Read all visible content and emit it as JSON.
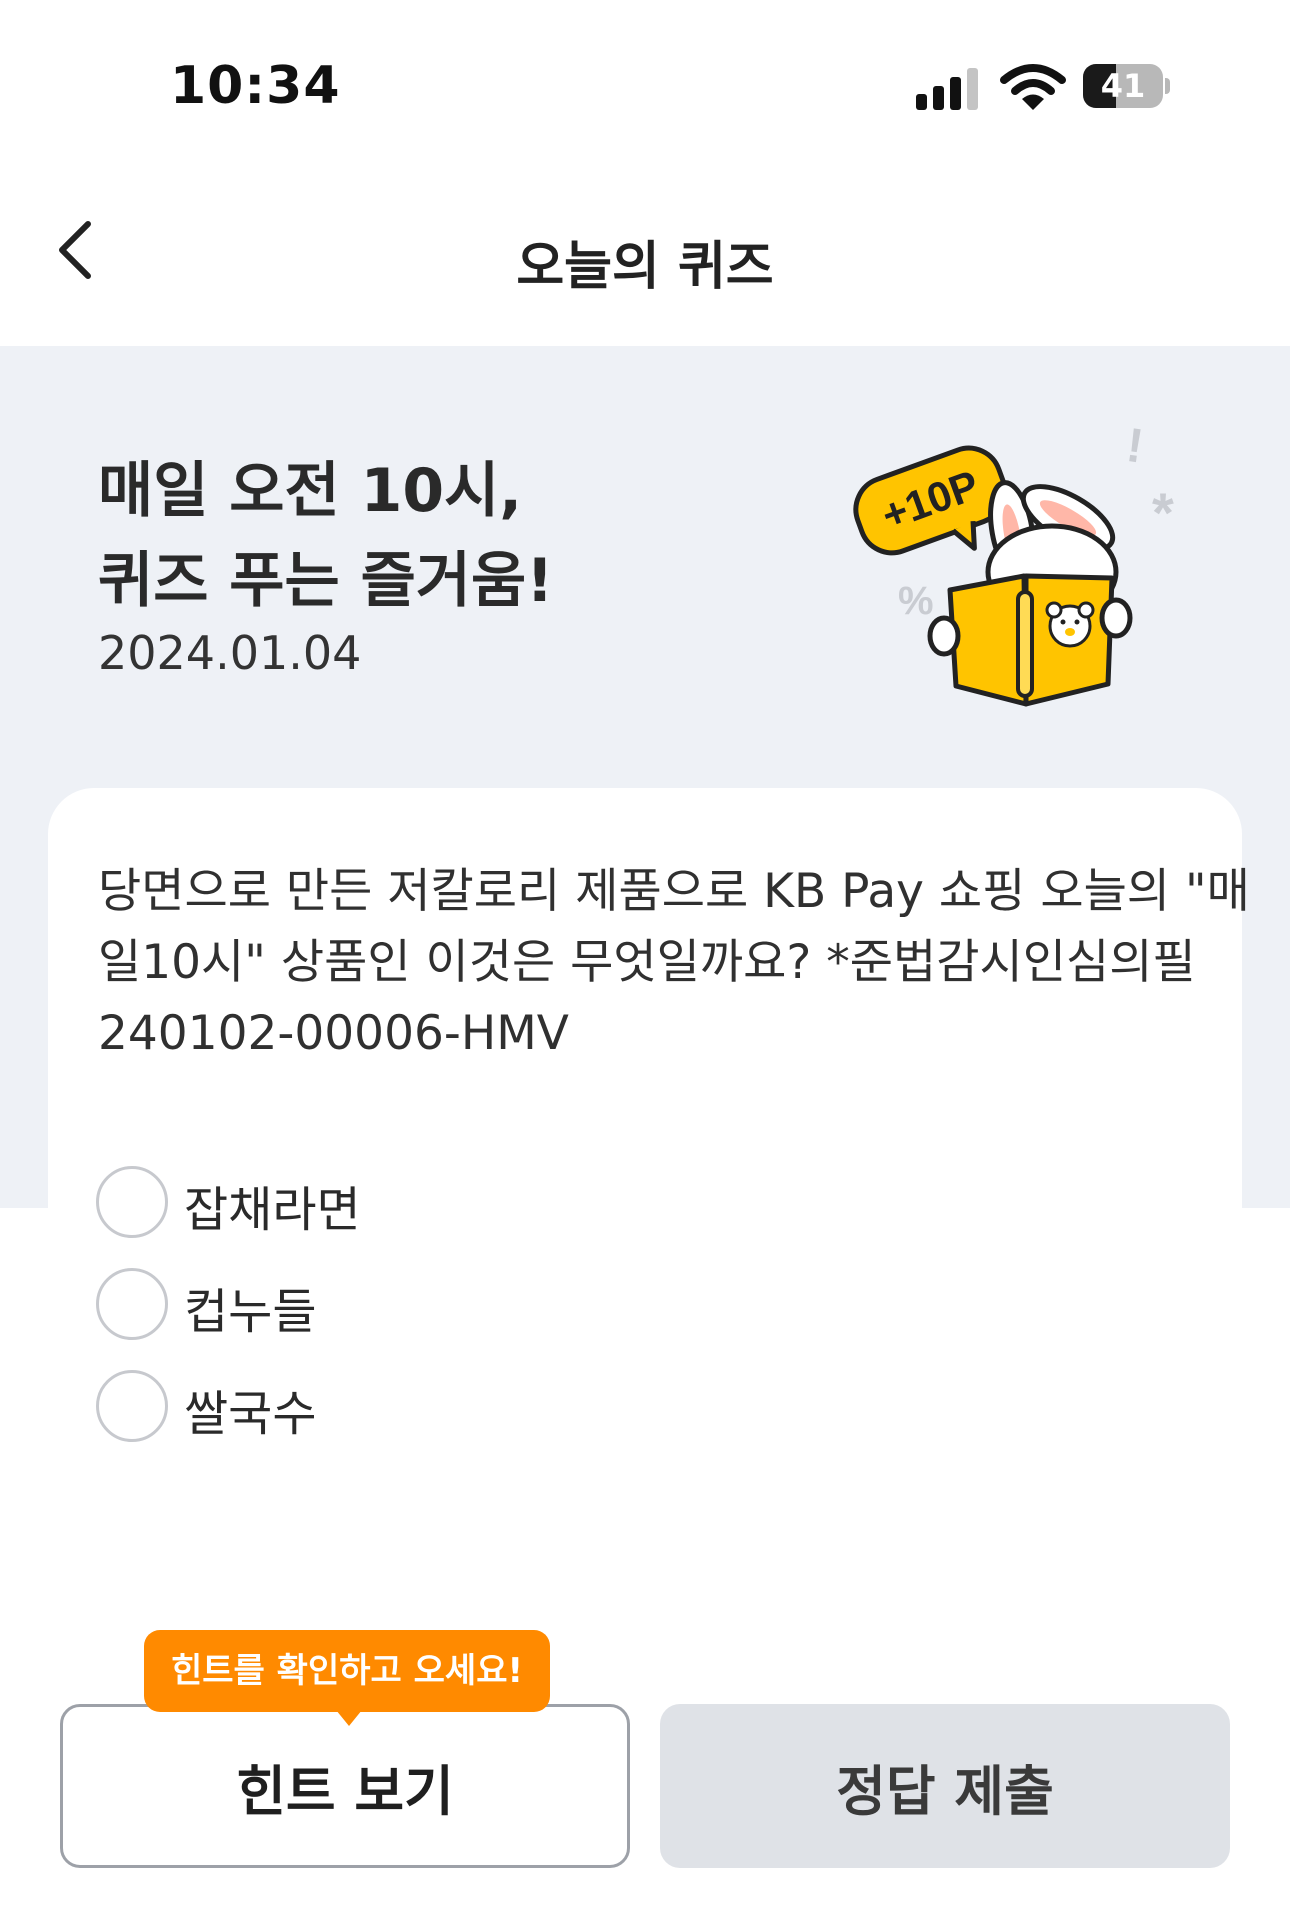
{
  "status_bar": {
    "time": "10:34",
    "battery_level": "41"
  },
  "nav": {
    "title": "오늘의 퀴즈"
  },
  "hero": {
    "title_line1": "매일 오전 10시,",
    "title_line2": "퀴즈 푸는 즐거움!",
    "date": "2024.01.04",
    "reward_badge": "+10P"
  },
  "quiz": {
    "question_lines": [
      "당면으로 만든 저칼로리 제품으로 KB Pay 쇼핑 오늘의 \"매",
      "일10시\" 상품인 이것은 무엇일까요? *준법감시인심의필",
      "240102-00006-HMV"
    ],
    "options": [
      {
        "label": "잡채라면"
      },
      {
        "label": "컵누들"
      },
      {
        "label": "쌀국수"
      }
    ]
  },
  "footer": {
    "hint_tooltip": "힌트를 확인하고 오세요!",
    "hint_button": "힌트 보기",
    "submit_button": "정답 제출"
  },
  "colors": {
    "accent_orange": "#ff8a00",
    "hero_bg": "#eef1f6",
    "book_yellow": "#ffc400",
    "submit_bg": "#dfe2e7"
  }
}
